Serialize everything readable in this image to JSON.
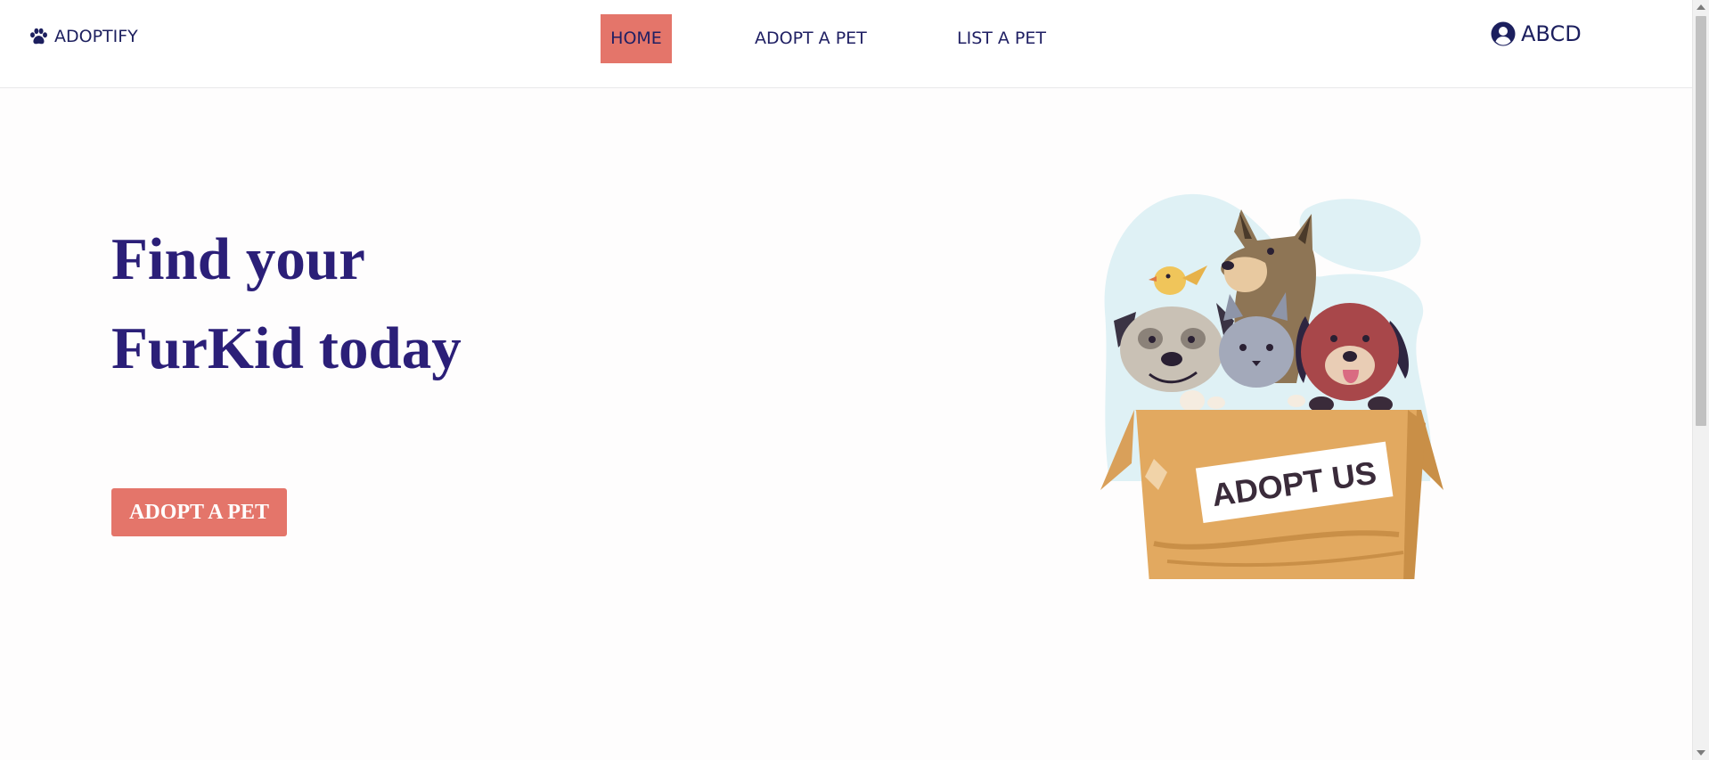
{
  "header": {
    "brand": {
      "label": "ADOPTIFY",
      "icon": "paw-icon"
    },
    "nav": [
      {
        "label": "HOME",
        "active": true
      },
      {
        "label": "ADOPT A PET",
        "active": false
      },
      {
        "label": "LIST A PET",
        "active": false
      }
    ],
    "account": {
      "label": "ABCD",
      "icon": "user-circle-icon"
    }
  },
  "hero": {
    "title_line1": "Find your",
    "title_line2": "FurKid today",
    "cta_label": "ADOPT A PET",
    "illustration": {
      "icon": "pets-in-box-illustration",
      "sign_text": "ADOPT US"
    }
  },
  "colors": {
    "primary_text": "#2b1f78",
    "nav_text": "#1f1f63",
    "accent": "#e4756a",
    "background": "#fefdfd"
  }
}
